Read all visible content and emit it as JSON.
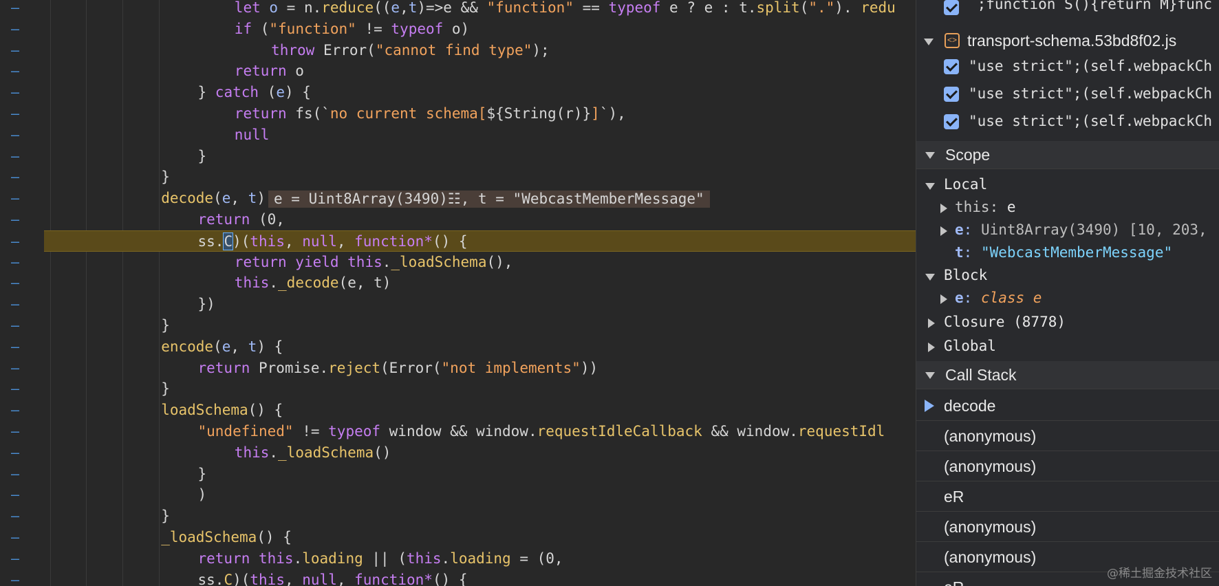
{
  "editor": {
    "lines": [
      {
        "indent": 6,
        "tokens": [
          [
            "kw",
            "let "
          ],
          [
            "var",
            "o"
          ],
          [
            "p",
            " = n."
          ],
          [
            "fn",
            "reduce"
          ],
          [
            "p",
            "(("
          ],
          [
            "var",
            "e"
          ],
          [
            "p",
            ","
          ],
          [
            "var",
            "t"
          ],
          [
            "p",
            ")=>e && "
          ],
          [
            "str",
            "\"function\""
          ],
          [
            "p",
            " == "
          ],
          [
            "kw",
            "typeof"
          ],
          [
            "p",
            " e ? e : t."
          ],
          [
            "fn",
            "split"
          ],
          [
            "p",
            "("
          ],
          [
            "str",
            "\".\""
          ],
          [
            "p",
            "). "
          ],
          [
            "fn",
            "redu"
          ]
        ]
      },
      {
        "indent": 6,
        "tokens": [
          [
            "kw",
            "if"
          ],
          [
            "p",
            " ("
          ],
          [
            "str",
            "\"function\""
          ],
          [
            "p",
            " != "
          ],
          [
            "kw",
            "typeof"
          ],
          [
            "p",
            " o)"
          ]
        ]
      },
      {
        "indent": 7,
        "tokens": [
          [
            "kw",
            "throw"
          ],
          [
            "p",
            " Error("
          ],
          [
            "str",
            "\"cannot find type\""
          ],
          [
            "p",
            ");"
          ]
        ]
      },
      {
        "indent": 6,
        "tokens": [
          [
            "kw",
            "return"
          ],
          [
            "p",
            " o"
          ]
        ]
      },
      {
        "indent": 5,
        "tokens": [
          [
            "p",
            "} "
          ],
          [
            "kw",
            "catch"
          ],
          [
            "p",
            " ("
          ],
          [
            "var",
            "e"
          ],
          [
            "p",
            ") {"
          ]
        ]
      },
      {
        "indent": 6,
        "tokens": [
          [
            "kw",
            "return"
          ],
          [
            "p",
            " fs(`"
          ],
          [
            "str",
            "no current schema["
          ],
          [
            "p",
            "${String(r)}"
          ],
          [
            "str",
            "]"
          ],
          [
            "p",
            "`),"
          ]
        ]
      },
      {
        "indent": 6,
        "tokens": [
          [
            "kw",
            "null"
          ]
        ]
      },
      {
        "indent": 5,
        "tokens": [
          [
            "p",
            "}"
          ]
        ]
      },
      {
        "indent": 4,
        "tokens": [
          [
            "p",
            "}"
          ]
        ]
      },
      {
        "indent": 4,
        "tokens": [
          [
            "fn",
            "decode"
          ],
          [
            "p",
            "("
          ],
          [
            "var",
            "e"
          ],
          [
            "p",
            ", "
          ],
          [
            "var",
            "t"
          ],
          [
            "p",
            ") {"
          ]
        ],
        "hint": "e = Uint8Array(3490)☷, t = \"WebcastMemberMessage\""
      },
      {
        "indent": 5,
        "tokens": [
          [
            "kw",
            "return"
          ],
          [
            "p",
            " (0,"
          ]
        ]
      },
      {
        "indent": 5,
        "highlight": true,
        "tokens": [
          [
            "p",
            "ss."
          ],
          [
            "cur",
            "C"
          ],
          [
            "p",
            ")("
          ],
          [
            "kw",
            "this"
          ],
          [
            "p",
            ", "
          ],
          [
            "kw",
            "null"
          ],
          [
            "p",
            ", "
          ],
          [
            "kw",
            "function*"
          ],
          [
            "p",
            "() {"
          ]
        ]
      },
      {
        "indent": 6,
        "tokens": [
          [
            "kw",
            "return yield this"
          ],
          [
            "p",
            "."
          ],
          [
            "fn",
            "_loadSchema"
          ],
          [
            "p",
            "(),"
          ]
        ]
      },
      {
        "indent": 6,
        "tokens": [
          [
            "kw",
            "this"
          ],
          [
            "p",
            "."
          ],
          [
            "fn",
            "_decode"
          ],
          [
            "p",
            "(e, t)"
          ]
        ]
      },
      {
        "indent": 5,
        "tokens": [
          [
            "p",
            "})"
          ]
        ]
      },
      {
        "indent": 4,
        "tokens": [
          [
            "p",
            "}"
          ]
        ]
      },
      {
        "indent": 4,
        "tokens": [
          [
            "fn",
            "encode"
          ],
          [
            "p",
            "("
          ],
          [
            "var",
            "e"
          ],
          [
            "p",
            ", "
          ],
          [
            "var",
            "t"
          ],
          [
            "p",
            ") {"
          ]
        ]
      },
      {
        "indent": 5,
        "tokens": [
          [
            "kw",
            "return"
          ],
          [
            "p",
            " Promise."
          ],
          [
            "fn",
            "reject"
          ],
          [
            "p",
            "(Error("
          ],
          [
            "str",
            "\"not implements\""
          ],
          [
            "p",
            "))"
          ]
        ]
      },
      {
        "indent": 4,
        "tokens": [
          [
            "p",
            "}"
          ]
        ]
      },
      {
        "indent": 4,
        "tokens": [
          [
            "fn",
            "loadSchema"
          ],
          [
            "p",
            "() {"
          ]
        ]
      },
      {
        "indent": 5,
        "tokens": [
          [
            "str",
            "\"undefined\""
          ],
          [
            "p",
            " != "
          ],
          [
            "kw",
            "typeof"
          ],
          [
            "p",
            " window && window."
          ],
          [
            "fn",
            "requestIdleCallback"
          ],
          [
            "p",
            " && window."
          ],
          [
            "fn",
            "requestIdl"
          ]
        ]
      },
      {
        "indent": 6,
        "tokens": [
          [
            "kw",
            "this"
          ],
          [
            "p",
            "."
          ],
          [
            "fn",
            "_loadSchema"
          ],
          [
            "p",
            "()"
          ]
        ]
      },
      {
        "indent": 5,
        "tokens": [
          [
            "p",
            "}"
          ]
        ]
      },
      {
        "indent": 5,
        "tokens": [
          [
            "p",
            ")"
          ]
        ]
      },
      {
        "indent": 4,
        "tokens": [
          [
            "p",
            "}"
          ]
        ]
      },
      {
        "indent": 4,
        "tokens": [
          [
            "fn",
            "_loadSchema"
          ],
          [
            "p",
            "() {"
          ]
        ]
      },
      {
        "indent": 5,
        "tokens": [
          [
            "kw",
            "return this"
          ],
          [
            "p",
            "."
          ],
          [
            "fn",
            "loading"
          ],
          [
            "p",
            " || ("
          ],
          [
            "kw",
            "this"
          ],
          [
            "p",
            "."
          ],
          [
            "fn",
            "loading"
          ],
          [
            "p",
            " = (0,"
          ]
        ]
      },
      {
        "indent": 5,
        "tokens": [
          [
            "p",
            "ss."
          ],
          [
            "fn",
            "C"
          ],
          [
            "p",
            ")("
          ],
          [
            "kw",
            "this"
          ],
          [
            "p",
            ", "
          ],
          [
            "kw",
            "null"
          ],
          [
            "p",
            ", "
          ],
          [
            "kw",
            "function*"
          ],
          [
            "p",
            "() {"
          ]
        ]
      }
    ],
    "gutter_mark": "–"
  },
  "panel": {
    "top_entry": "`;function S(){return M}func",
    "file_name": "transport-schema.53bd8f02.js",
    "file_entries": [
      "\"use strict\";(self.webpackCh",
      "\"use strict\";(self.webpackCh",
      "\"use strict\";(self.webpackCh"
    ],
    "scope_title": "Scope",
    "local_title": "Local",
    "local_this_key": "this",
    "local_this_val": "e",
    "local_e_key": "e",
    "local_e_val": "Uint8Array(3490) [10, 203,",
    "local_t_key": "t",
    "local_t_val": "\"WebcastMemberMessage\"",
    "block_title": "Block",
    "block_e_key": "e",
    "block_e_val": "class e",
    "closure_label": "Closure (8778)",
    "global_label": "Global",
    "callstack_title": "Call Stack",
    "frames": [
      "decode",
      "(anonymous)",
      "(anonymous)",
      "eR",
      "(anonymous)",
      "(anonymous)",
      "eR"
    ],
    "watermark": "@稀土掘金技术社区",
    "colors": {
      "accent": "#8ab4f8",
      "string": "#f2a35d",
      "keyword": "#c67ef2",
      "function": "#e8c46a"
    }
  }
}
